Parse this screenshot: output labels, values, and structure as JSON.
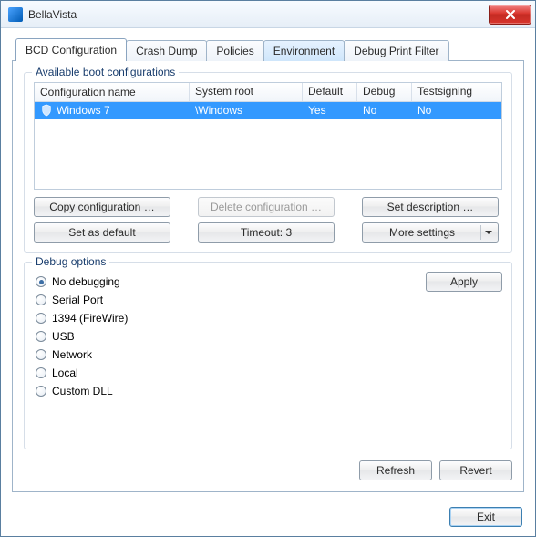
{
  "window": {
    "title": "BellaVista"
  },
  "tabs": [
    {
      "label": "BCD Configuration",
      "active": true
    },
    {
      "label": "Crash Dump"
    },
    {
      "label": "Policies"
    },
    {
      "label": "Environment",
      "highlight": true
    },
    {
      "label": "Debug Print Filter"
    }
  ],
  "boot_group_label": "Available boot configurations",
  "columns": {
    "name": "Configuration name",
    "root": "System root",
    "default": "Default",
    "debug": "Debug",
    "testsigning": "Testsigning"
  },
  "rows": [
    {
      "name": "Windows 7",
      "root": "\\Windows",
      "default": "Yes",
      "debug": "No",
      "testsigning": "No",
      "selected": true
    }
  ],
  "buttons": {
    "copy": "Copy configuration …",
    "delete": "Delete configuration …",
    "set_desc": "Set description …",
    "set_default": "Set as default",
    "timeout": "Timeout: 3",
    "more": "More settings"
  },
  "debug_group_label": "Debug options",
  "debug_options": [
    {
      "label": "No debugging",
      "checked": true
    },
    {
      "label": "Serial Port"
    },
    {
      "label": "1394 (FireWire)"
    },
    {
      "label": "USB"
    },
    {
      "label": "Network"
    },
    {
      "label": "Local"
    },
    {
      "label": "Custom DLL"
    }
  ],
  "apply_label": "Apply",
  "refresh_label": "Refresh",
  "revert_label": "Revert",
  "exit_label": "Exit"
}
